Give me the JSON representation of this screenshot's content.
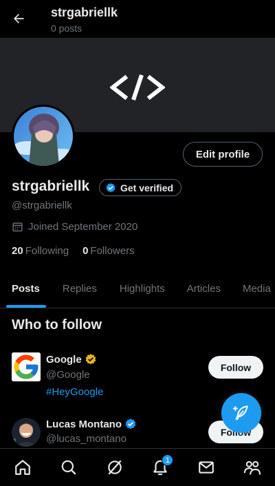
{
  "header": {
    "title": "strgabriellk",
    "subtitle": "0 posts"
  },
  "banner": {
    "logo_icon": "code-brackets-icon"
  },
  "profile": {
    "edit_label": "Edit profile",
    "name": "strgabriellk",
    "verify_label": "Get verified",
    "handle": "@strgabriellk",
    "joined": "Joined September 2020",
    "following_count": "20",
    "following_label": "Following",
    "followers_count": "0",
    "followers_label": "Followers"
  },
  "tabs": [
    {
      "label": "Posts",
      "active": true
    },
    {
      "label": "Replies"
    },
    {
      "label": "Highlights"
    },
    {
      "label": "Articles"
    },
    {
      "label": "Media"
    }
  ],
  "who_to_follow": {
    "title": "Who to follow",
    "items": [
      {
        "name": "Google",
        "handle": "@Google",
        "tag": "#HeyGoogle",
        "badge": "gold-check",
        "button": "Follow"
      },
      {
        "name": "Lucas Montano",
        "handle": "@lucas_montano",
        "badge": "blue-check",
        "button": "Follow"
      }
    ]
  },
  "bottom_nav": {
    "items": [
      "home-icon",
      "search-icon",
      "grok-icon",
      "notifications-icon",
      "messages-icon",
      "communities-icon"
    ],
    "notification_badge": "1"
  },
  "colors": {
    "accent": "#1d9bf0",
    "gold": "#e2b719",
    "background": "#000000",
    "muted": "#71767b"
  }
}
